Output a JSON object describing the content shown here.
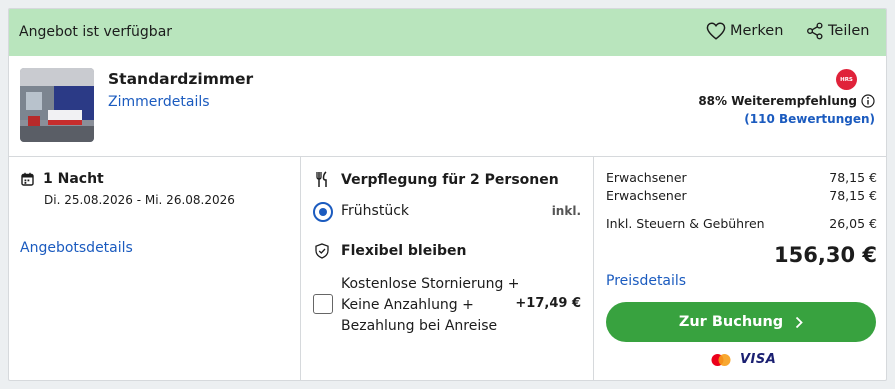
{
  "banner": {
    "status_text": "Angebot ist verfügbar",
    "save_label": "Merken",
    "share_label": "Teilen"
  },
  "room": {
    "title": "Standardzimmer",
    "details_link": "Zimmerdetails",
    "hrs_badge": "HRS",
    "recommendation": "88% Weiterempfehlung",
    "reviews": "(110 Bewertungen)"
  },
  "stay": {
    "nights": "1 Nacht",
    "dates": "Di. 25.08.2026 - Mi. 26.08.2026",
    "offer_link": "Angebotsdetails"
  },
  "meals": {
    "heading": "Verpflegung für 2 Personen",
    "option_label": "Frühstück",
    "option_price": "inkl."
  },
  "flexibility": {
    "heading": "Flexibel bleiben",
    "option_lines": [
      "Kostenlose Stornierung +",
      "Keine Anzahlung +",
      "Bezahlung bei Anreise"
    ],
    "option_price": "+17,49 €"
  },
  "pricing": {
    "rows": [
      {
        "label": "Erwachsener",
        "value": "78,15 €"
      },
      {
        "label": "Erwachsener",
        "value": "78,15 €"
      },
      {
        "label": "Inkl. Steuern & Gebühren",
        "value": "26,05 €"
      }
    ],
    "total": "156,30 €",
    "details_link": "Preisdetails",
    "book_label": "Zur Buchung",
    "payment_visa": "VISA"
  },
  "icons": {
    "save": "heart-icon",
    "share": "share-icon",
    "info": "info-icon",
    "calendar": "calendar-icon",
    "meal": "cutlery-icon",
    "shield": "shield-icon",
    "chevron": "chevron-right-icon",
    "mastercard": "mastercard-icon"
  },
  "colors": {
    "banner_bg": "#b9e5bd",
    "link": "#1b5bbf",
    "book_button": "#38a23f",
    "hrs_badge": "#e0223a"
  }
}
